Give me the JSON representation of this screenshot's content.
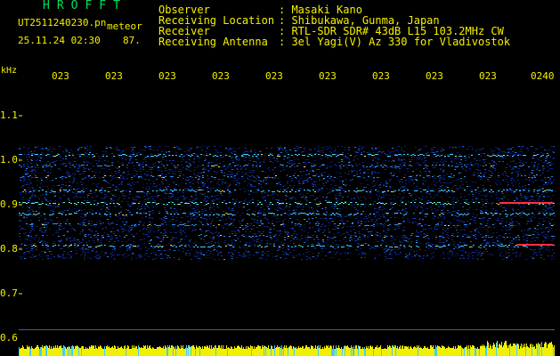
{
  "header": {
    "app_title": "HROFFT",
    "filename": "UT2511240230.pn",
    "mode": "meteor",
    "datetime": "25.11.24 02:30",
    "count": "87."
  },
  "meta": {
    "observer_label": "Observer",
    "observer_value": ": Masaki Kano",
    "location_label": "Receiving Location",
    "location_value": ": Shibukawa, Gunma, Japan",
    "receiver_label": "Receiver",
    "receiver_value": ": RTL-SDR SDR# 43dB L15 103.2MHz CW",
    "antenna_label": "Receiving Antenna",
    "antenna_value": ": 3el Yagi(V) Az 330 for Vladivostok"
  },
  "axis": {
    "unit": "kHz",
    "y_ticks": [
      "1.1",
      "1.0",
      "0.9",
      "0.8",
      "0.7",
      "0.6"
    ],
    "x_ticks": [
      "023",
      "023",
      "023",
      "023",
      "023",
      "023",
      "023",
      "023",
      "023",
      "0240"
    ]
  },
  "colors": {
    "text": "#f4f000",
    "title": "#00e060",
    "background": "#000000",
    "baseline": "#7fc7ff"
  }
}
